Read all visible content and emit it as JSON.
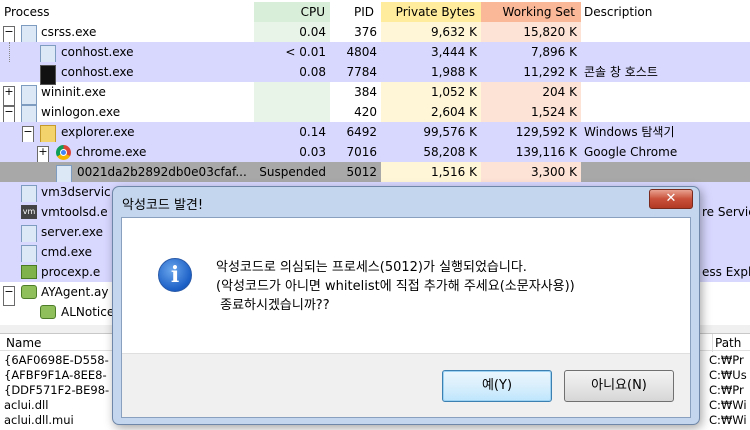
{
  "header": {
    "process": "Process",
    "cpu": "CPU",
    "pid": "PID",
    "private_bytes": "Private Bytes",
    "working_set": "Working Set",
    "description": "Description"
  },
  "processes": [
    {
      "name": "csrss.exe",
      "cpu": "0.04",
      "pid": "376",
      "private": "9,632 K",
      "working": "15,820 K",
      "desc": ""
    },
    {
      "name": "conhost.exe",
      "cpu": "< 0.01",
      "pid": "4804",
      "private": "3,444 K",
      "working": "7,896 K",
      "desc": ""
    },
    {
      "name": "conhost.exe",
      "cpu": "0.08",
      "pid": "7784",
      "private": "1,988 K",
      "working": "11,292 K",
      "desc": "콘솔 창 호스트"
    },
    {
      "name": "wininit.exe",
      "cpu": "",
      "pid": "384",
      "private": "1,052 K",
      "working": "204 K",
      "desc": ""
    },
    {
      "name": "winlogon.exe",
      "cpu": "",
      "pid": "420",
      "private": "2,604 K",
      "working": "1,524 K",
      "desc": ""
    },
    {
      "name": "explorer.exe",
      "cpu": "0.14",
      "pid": "6492",
      "private": "99,576 K",
      "working": "129,592 K",
      "desc": "Windows 탐색기"
    },
    {
      "name": "chrome.exe",
      "cpu": "0.03",
      "pid": "7016",
      "private": "58,208 K",
      "working": "139,116 K",
      "desc": "Google Chrome"
    },
    {
      "name": "0021da2b2892db0e03cfaf...",
      "cpu": "Suspended",
      "pid": "5012",
      "private": "1,516 K",
      "working": "3,300 K",
      "desc": ""
    },
    {
      "name": "vm3dservic",
      "cpu": "",
      "pid": "",
      "private": "",
      "working": "",
      "desc": ""
    },
    {
      "name": "vmtoolsd.e",
      "cpu": "",
      "pid": "",
      "private": "",
      "working": "",
      "desc": "re Service"
    },
    {
      "name": "server.exe",
      "cpu": "",
      "pid": "",
      "private": "",
      "working": "",
      "desc": ""
    },
    {
      "name": "cmd.exe",
      "cpu": "",
      "pid": "",
      "private": "",
      "working": "",
      "desc": ""
    },
    {
      "name": "procexp.e",
      "cpu": "",
      "pid": "",
      "private": "",
      "working": "",
      "desc": "ess Expl..."
    },
    {
      "name": "AYAgent.ay",
      "cpu": "",
      "pid": "",
      "private": "",
      "working": "",
      "desc": ""
    },
    {
      "name": "ALNotice",
      "cpu": "",
      "pid": "",
      "private": "",
      "working": "",
      "desc": ""
    }
  ],
  "lower": {
    "name_header": "Name",
    "path_header": "Path",
    "rows": [
      {
        "name": "{6AF0698E-D558-",
        "path": "C:₩Pr"
      },
      {
        "name": "{AFBF9F1A-8EE8-",
        "path": "C:₩Us"
      },
      {
        "name": "{DDF571F2-BE98-",
        "path": "C:₩Pr"
      },
      {
        "name": "aclui.dll",
        "path": "C:₩Wi"
      },
      {
        "name": "aclui.dll.mui",
        "path": "C:₩Wi"
      }
    ]
  },
  "dialog": {
    "title": "악성코드 발견!",
    "close": "✕",
    "line1": "악성코드로 의심되는 프로세스(5012)가 실행되었습니다.",
    "line2": "(악성코드가 아니면 whitelist에 직접 추가해 주세요(소문자사용))",
    "line3": " 종료하시겠습니까??",
    "yes": "예(Y)",
    "no": "아니요(N)"
  },
  "colors": {
    "cpu_col": "#e8f4e8",
    "private_col": "#fff2c8",
    "working_col": "#fdd0bc",
    "service_row": "#d8d8ff",
    "suspended_row": "#a8a8a8",
    "dialog_frame": "#c3d6ee"
  }
}
